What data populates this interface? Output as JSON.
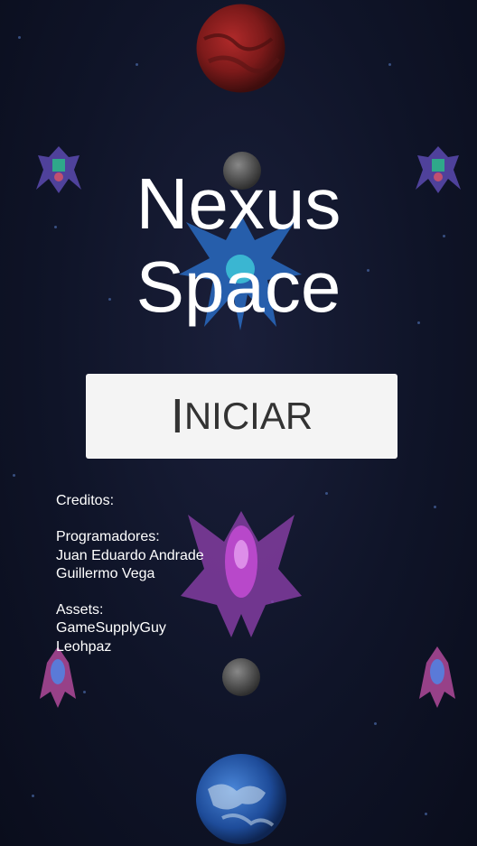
{
  "game": {
    "title_line1": "Nexus",
    "title_line2": "Space",
    "start_button": {
      "first_letter": "I",
      "rest": "NICIAR"
    },
    "credits": {
      "heading": "Creditos:",
      "programmers_heading": "Programadores:",
      "programmers": [
        "Juan Eduardo Andrade",
        "Guillermo Vega"
      ],
      "assets_heading": "Assets:",
      "assets": [
        "GameSupplyGuy",
        "Leohpaz"
      ]
    }
  },
  "sprites": [
    {
      "name": "red-planet-icon",
      "color": "#8a1f1f"
    },
    {
      "name": "grey-moon-icon",
      "color": "#555555"
    },
    {
      "name": "blue-alien-ship-icon",
      "color": "#2a6fc9"
    },
    {
      "name": "purple-boss-ship-icon",
      "color": "#b04ad0"
    },
    {
      "name": "earth-planet-icon",
      "color": "#2a5fb0"
    }
  ]
}
